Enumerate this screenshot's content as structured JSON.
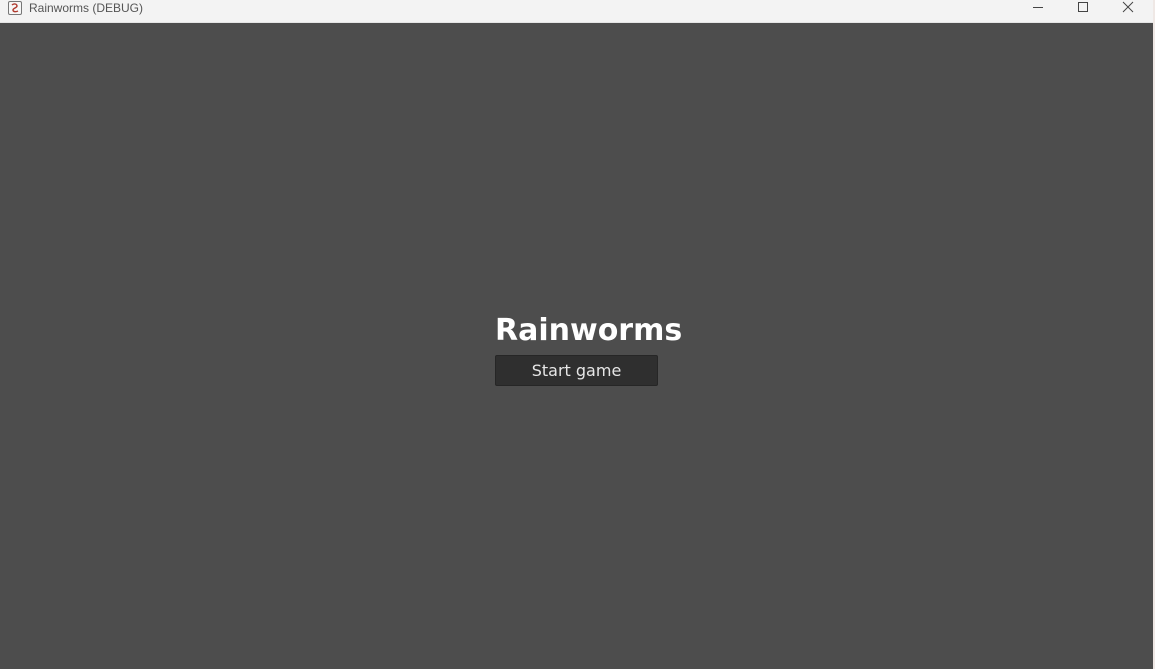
{
  "window": {
    "title": "Rainworms (DEBUG)",
    "background_color": "#4d4d4d",
    "icons": {
      "app": "app-icon",
      "minimize": "minimize-icon",
      "maximize": "maximize-icon",
      "close": "close-icon"
    }
  },
  "main_menu": {
    "title": "Rainworms",
    "start_button_label": "Start game",
    "button_color": "#2f2f2f",
    "text_color": "#ffffff"
  }
}
